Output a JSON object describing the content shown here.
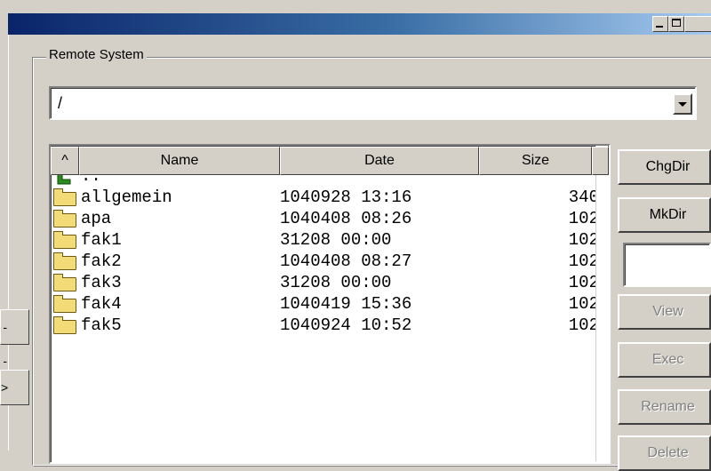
{
  "window": {
    "minimize_glyph": "_",
    "maximize_glyph": "□"
  },
  "left_buttons": [
    {
      "label": "--",
      "icon": "ellipsis"
    },
    {
      "label": ">",
      "icon": "arrow-right"
    }
  ],
  "remote": {
    "group_label": "Remote System",
    "path_value": "/",
    "columns": {
      "sort_indicator": "^",
      "name": "Name",
      "date": "Date",
      "size": "Size"
    },
    "files": [
      {
        "name": "..",
        "date": "",
        "size": "",
        "icon": "up-arrow-icon"
      },
      {
        "name": "allgemein",
        "date": "1040928 13:16",
        "size": "340",
        "icon": "folder-icon"
      },
      {
        "name": "apa",
        "date": "1040408 08:26",
        "size": "102",
        "icon": "folder-icon"
      },
      {
        "name": "fak1",
        "date": "31208 00:00",
        "size": "102",
        "icon": "folder-icon"
      },
      {
        "name": "fak2",
        "date": "1040408 08:27",
        "size": "102",
        "icon": "folder-icon"
      },
      {
        "name": "fak3",
        "date": "31208 00:00",
        "size": "102",
        "icon": "folder-icon"
      },
      {
        "name": "fak4",
        "date": "1040419 15:36",
        "size": "102",
        "icon": "folder-icon"
      },
      {
        "name": "fak5",
        "date": "1040924 10:52",
        "size": "102",
        "icon": "folder-icon"
      }
    ],
    "buttons": {
      "chgdir": "ChgDir",
      "mkdir": "MkDir",
      "view": "View",
      "exec": "Exec",
      "rename": "Rename",
      "delete": "Delete"
    },
    "colors": {
      "titlebar_start": "#0a246a",
      "titlebar_end": "#a6caf0",
      "folder": "#f3dc78",
      "up_arrow": "#2e8b1f"
    }
  }
}
